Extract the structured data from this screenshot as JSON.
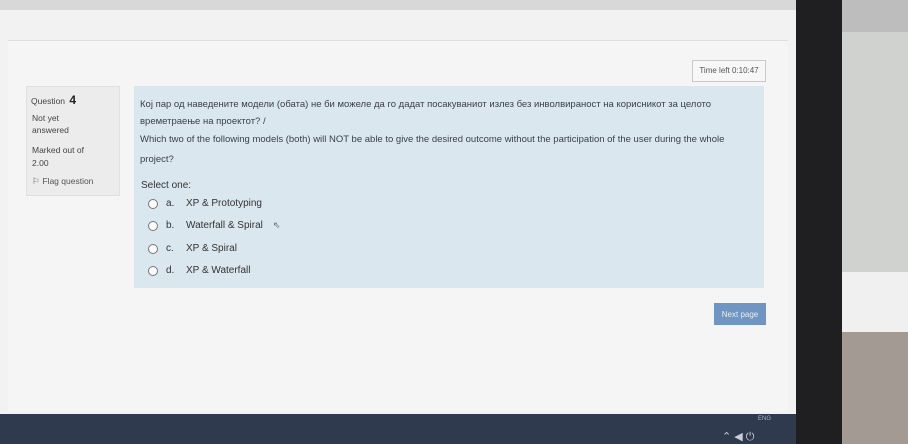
{
  "quiz": {
    "timer_label": "Time left 0:10:47",
    "question_label": "Question",
    "question_number": "4",
    "state_line1": "Not yet",
    "state_line2": "answered",
    "marked_line1": "Marked out of",
    "marked_line2": "2.00",
    "flag_label": "Flag question",
    "question_mk_line1": "Кој пар од наведените модели (обата) не би можеле да го дадат посакуваниот излез без инволвираност на корисникот за целото",
    "question_mk_line2": "времетраење на проектот? /",
    "question_en_line1": "Which two of the following models (both) will NOT be able to give the desired outcome without the participation of the user during the whole",
    "question_en_line2": "project?",
    "select_one": "Select one:",
    "options": [
      {
        "letter": "a.",
        "text": "XP & Prototyping"
      },
      {
        "letter": "b.",
        "text": "Waterfall & Spiral"
      },
      {
        "letter": "c.",
        "text": "XP & Spiral"
      },
      {
        "letter": "d.",
        "text": "XP & Waterfall"
      }
    ],
    "next_button": "Next page"
  },
  "taskbar": {
    "lang": "ENG"
  }
}
